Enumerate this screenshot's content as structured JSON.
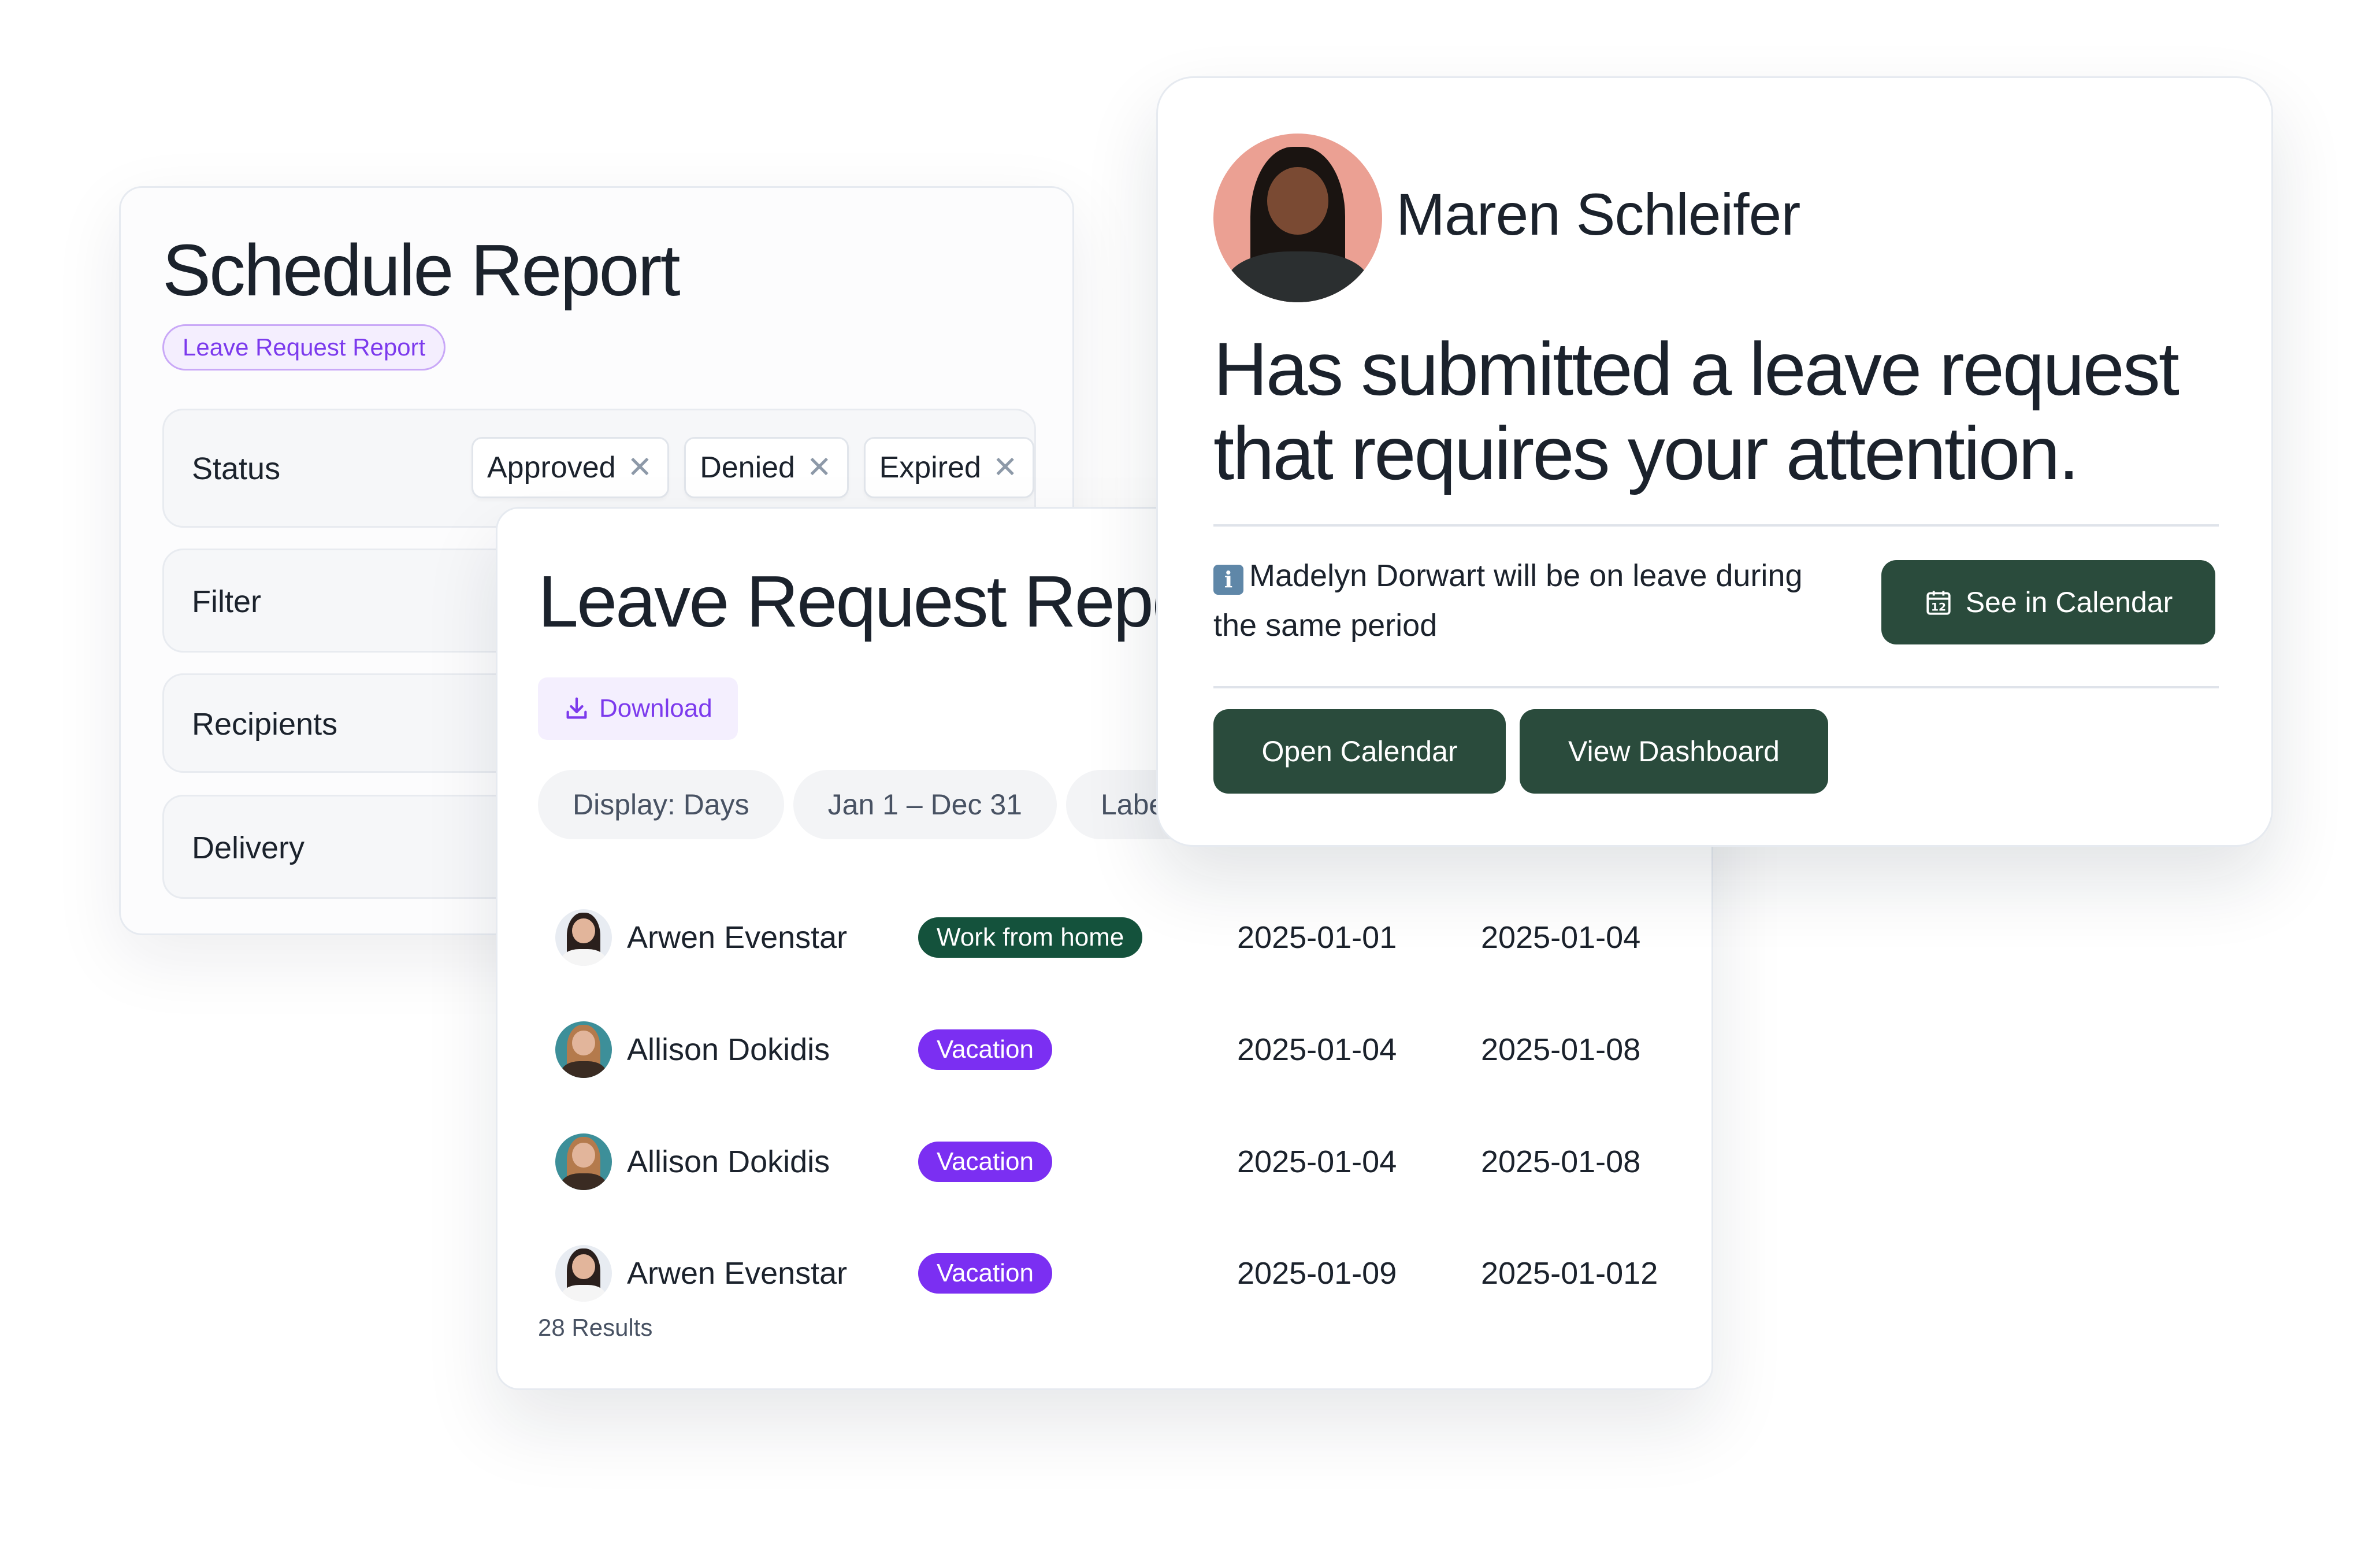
{
  "schedule_report": {
    "title": "Schedule Report",
    "tag": "Leave Request Report",
    "sections": [
      {
        "label": "Status",
        "chips": [
          "Approved",
          "Denied",
          "Expired"
        ]
      },
      {
        "label": "Filter"
      },
      {
        "label": "Recipients"
      },
      {
        "label": "Delivery"
      }
    ],
    "chip_remove_icon": "close-icon"
  },
  "leave_report": {
    "title": "Leave Request Report",
    "download_label": "Download",
    "download_icon": "download-icon",
    "filters": [
      "Display: Days",
      "Jan 1 – Dec 31",
      "Labels"
    ],
    "rows": [
      {
        "name": "Arwen Evenstar",
        "avatar": "arwen",
        "type": "Work from home",
        "type_color": "#14523c",
        "start": "2025-01-01",
        "end": "2025-01-04"
      },
      {
        "name": "Allison Dokidis",
        "avatar": "allison",
        "type": "Vacation",
        "type_color": "#7b2ff2",
        "start": "2025-01-04",
        "end": "2025-01-08"
      },
      {
        "name": "Allison Dokidis",
        "avatar": "allison",
        "type": "Vacation",
        "type_color": "#7b2ff2",
        "start": "2025-01-04",
        "end": "2025-01-08"
      },
      {
        "name": "Arwen Evenstar",
        "avatar": "arwen",
        "type": "Vacation",
        "type_color": "#7b2ff2",
        "start": "2025-01-09",
        "end": "2025-01-012"
      }
    ],
    "results": "28 Results"
  },
  "notification": {
    "name": "Maren Schleifer",
    "headline": "Has submitted a leave request that requires your attention.",
    "info_icon": "info-icon",
    "info_text": "Madelyn Dorwart will be on leave during the same period",
    "see_calendar_label": "See in Calendar",
    "calendar_icon_day": "12",
    "open_calendar_label": "Open Calendar",
    "view_dashboard_label": "View Dashboard"
  },
  "colors": {
    "accent_purple": "#7c3aed",
    "primary_green": "#2a4b3c",
    "badge_green": "#14523c",
    "badge_purple": "#7b2ff2"
  }
}
